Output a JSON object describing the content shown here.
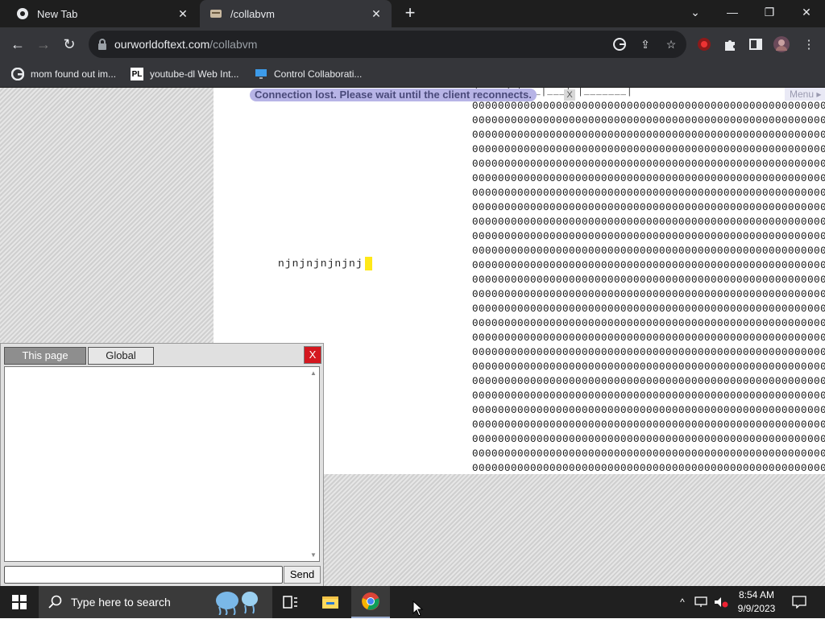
{
  "browser": {
    "tabs": [
      {
        "title": "New Tab",
        "active": false
      },
      {
        "title": "/collabvm",
        "active": true
      }
    ],
    "omnibox": {
      "domain": "ourworldoftext.com",
      "path": "/collabvm"
    },
    "bookmarks": [
      {
        "label": "mom found out im...",
        "icon": "google-icon"
      },
      {
        "label": "youtube-dl Web Int...",
        "icon": "yt-dl-icon"
      },
      {
        "label": "Control Collaborati...",
        "icon": "monitor-icon"
      }
    ]
  },
  "page": {
    "banner": "Connection lost. Please wait until the client reconnects.",
    "banner_close": "X",
    "menu": "Menu",
    "typed_text": "njnjnjnjnjnj",
    "ascii_top": "|____/  |___|___|  |_______|",
    "zero_row": "00000000000000000000000000000000000000000000000000000000",
    "zero_rows": 26
  },
  "chat": {
    "tabs": [
      {
        "label": "This page",
        "active": true
      },
      {
        "label": "Global",
        "active": false
      }
    ],
    "close": "X",
    "send": "Send",
    "input_value": ""
  },
  "taskbar": {
    "search_placeholder": "Type here to search",
    "time": "8:54 AM",
    "date": "9/9/2023"
  },
  "colors": {
    "banner_bg": "#b7b4e6",
    "cursor": "#ffe818",
    "chat_close": "#d4171f",
    "chrome_dark": "#35363a"
  }
}
